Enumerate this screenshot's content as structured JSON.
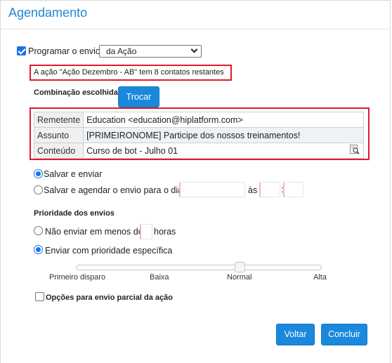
{
  "dialog": {
    "title": "Agendamento"
  },
  "schedule": {
    "checkbox_label": "Programar o envio",
    "checked": true,
    "select_value": "da Ação"
  },
  "notice": "A ação \"Ação Dezembro - AB\" tem 8 contatos restantes",
  "combination": {
    "label": "Combinação escolhida",
    "swap_button": "Trocar",
    "rows": [
      {
        "key": "Remetente",
        "value": "Education <education@hiplatform.com>"
      },
      {
        "key": "Assunto",
        "value": "[PRIMEIRONOME] Participe dos nossos treinamentos!"
      },
      {
        "key": "Conteúdo",
        "value": "Curso de bot - Julho 01"
      }
    ]
  },
  "send_mode": {
    "options": [
      {
        "label": "Salvar e enviar",
        "selected": true
      },
      {
        "label": "Salvar e agendar o envio para o dia",
        "selected": false
      }
    ],
    "at_label": "às",
    "time_separator": ":"
  },
  "priority": {
    "heading": "Prioridade dos envios",
    "options": [
      {
        "label_before": "Não enviar em menos de",
        "label_after": "horas",
        "selected": false
      },
      {
        "label": "Enviar com prioridade específica",
        "selected": true
      }
    ],
    "slider": {
      "labels": [
        "Primeiro disparo",
        "Baixa",
        "Normal",
        "Alta"
      ],
      "value": "Normal"
    }
  },
  "partial": {
    "label": "Opções para envio parcial da ação",
    "checked": false
  },
  "footer": {
    "back_button": "Voltar",
    "finish_button": "Concluir"
  },
  "colors": {
    "accent": "#1a88dc",
    "title": "#1f86d1",
    "highlight": "#e01b2c"
  }
}
